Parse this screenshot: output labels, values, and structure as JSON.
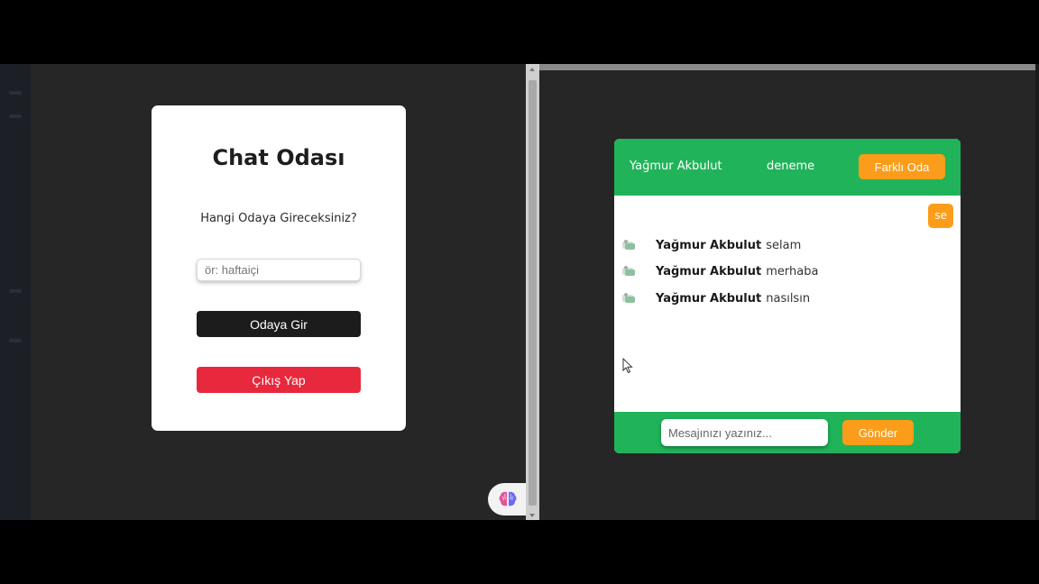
{
  "login": {
    "title": "Chat Odası",
    "question": "Hangi Odaya Gireceksiniz?",
    "room_placeholder": "ör: haftaiçi",
    "enter_label": "Odaya Gir",
    "logout_label": "Çıkış Yap"
  },
  "chat": {
    "username": "Yağmur Akbulut",
    "room": "deneme",
    "change_room_label": "Farklı Oda",
    "own_message": "se",
    "messages": [
      {
        "sender": "Yağmur Akbulut",
        "text": "selam"
      },
      {
        "sender": "Yağmur Akbulut",
        "text": "merhaba"
      },
      {
        "sender": "Yağmur Akbulut",
        "text": "nasılsın"
      }
    ],
    "message_placeholder": "Mesajınızı yazınız...",
    "send_label": "Gönder"
  },
  "icons": {
    "avatar": "chat-avatar-icon",
    "fab": "brain-icon",
    "cursor": "mouse-pointer-icon"
  },
  "colors": {
    "header_green": "#21b35a",
    "accent_orange": "#fb9d1a",
    "logout_red": "#e8283c",
    "enter_dark": "#1c1c1c"
  }
}
